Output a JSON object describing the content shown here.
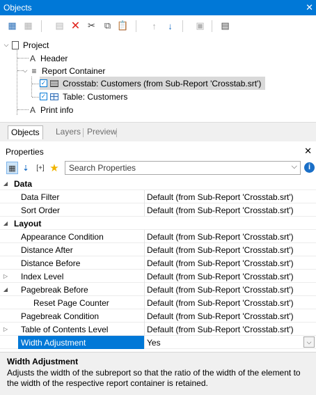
{
  "window": {
    "title": "Objects",
    "close_glyph": "✕"
  },
  "toolbar": {
    "icons": [
      "new-element-icon",
      "new-container-icon",
      "properties-icon",
      "delete-icon",
      "cut-icon",
      "copy-icon",
      "paste-icon",
      "move-up-icon",
      "move-down-icon",
      "layers-icon",
      "report-icon"
    ]
  },
  "tree": {
    "nodes": {
      "project": "Project",
      "header": "Header",
      "report_container": "Report Container",
      "crosstab": "Crosstab: Customers (from Sub-Report 'Crosstab.srt')",
      "table": "Table: Customers",
      "print_info": "Print info"
    }
  },
  "tabs": [
    {
      "label": "Objects",
      "active": true
    },
    {
      "label": "Layers",
      "active": false
    },
    {
      "label": "Preview",
      "active": false
    }
  ],
  "properties": {
    "title": "Properties",
    "search_placeholder": "Search Properties",
    "rows": [
      {
        "type": "category",
        "expander": "◢",
        "name": "Data"
      },
      {
        "type": "prop",
        "name": "Data Filter",
        "value": "Default (from Sub-Report 'Crosstab.srt')"
      },
      {
        "type": "prop",
        "name": "Sort Order",
        "value": "Default (from Sub-Report 'Crosstab.srt')"
      },
      {
        "type": "category",
        "expander": "◢",
        "name": "Layout"
      },
      {
        "type": "prop",
        "name": "Appearance Condition",
        "value": "Default (from Sub-Report 'Crosstab.srt')"
      },
      {
        "type": "prop",
        "name": "Distance After",
        "value": "Default (from Sub-Report 'Crosstab.srt')"
      },
      {
        "type": "prop",
        "name": "Distance Before",
        "value": "Default (from Sub-Report 'Crosstab.srt')"
      },
      {
        "type": "prop",
        "expander": "▷",
        "name": "Index Level",
        "value": "Default (from Sub-Report 'Crosstab.srt')"
      },
      {
        "type": "prop",
        "expander": "◢",
        "name": "Pagebreak Before",
        "value": "Default (from Sub-Report 'Crosstab.srt')"
      },
      {
        "type": "prop",
        "indent": true,
        "name": "Reset Page Counter",
        "value": "Default (from Sub-Report 'Crosstab.srt')"
      },
      {
        "type": "prop",
        "name": "Pagebreak Condition",
        "value": "Default (from Sub-Report 'Crosstab.srt')"
      },
      {
        "type": "prop",
        "expander": "▷",
        "name": "Table of Contents Level",
        "value": "Default (from Sub-Report 'Crosstab.srt')"
      },
      {
        "type": "prop",
        "selected": true,
        "name": "Width Adjustment",
        "value": "Yes",
        "dropdown": true
      }
    ]
  },
  "description": {
    "title": "Width Adjustment",
    "text": "Adjusts the width of the subreport so that the ratio of the width of the element to the width of the respective report container is retained."
  }
}
